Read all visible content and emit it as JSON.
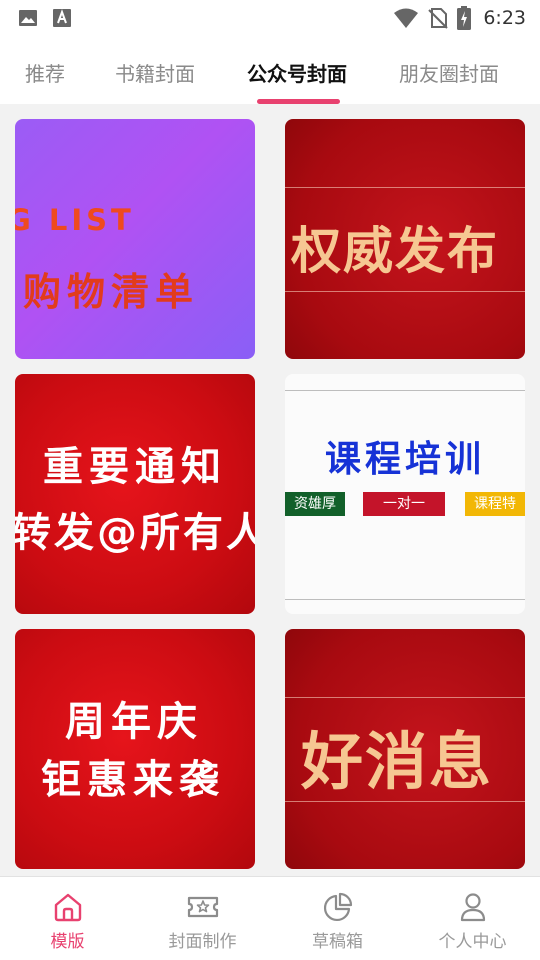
{
  "status_bar": {
    "time": "6:23",
    "icons": [
      "image-icon",
      "text-a-icon",
      "wifi-icon",
      "no-sim-icon",
      "battery-charging-icon"
    ]
  },
  "tabs": [
    {
      "label": "推荐",
      "active": false
    },
    {
      "label": "书籍封面",
      "active": false
    },
    {
      "label": "公众号封面",
      "active": true
    },
    {
      "label": "朋友圈封面",
      "active": false
    }
  ],
  "colors": {
    "accent": "#e8416f",
    "gold_text": "#f6c792",
    "blue_title": "#1632d6"
  },
  "cards": {
    "shopping": {
      "en": "G LIST",
      "cn": "购物清单"
    },
    "authority": {
      "title": "权威发布"
    },
    "notice": {
      "line1": "重要通知",
      "line2": "转发@所有人"
    },
    "course": {
      "title": "课程培训",
      "pills": [
        {
          "text": "资雄厚",
          "color": "#12602a"
        },
        {
          "text": "一对一",
          "color": "#c4142a"
        },
        {
          "text": "课程特",
          "color": "#f2b705"
        }
      ]
    },
    "anniversary": {
      "line1": "周年庆",
      "line2": "钜惠来袭"
    },
    "good_news": {
      "title": "好消息"
    }
  },
  "bottom_nav": [
    {
      "label": "模版",
      "icon": "home-icon",
      "active": true
    },
    {
      "label": "封面制作",
      "icon": "ticket-star-icon",
      "active": false
    },
    {
      "label": "草稿箱",
      "icon": "pie-chart-icon",
      "active": false
    },
    {
      "label": "个人中心",
      "icon": "person-icon",
      "active": false
    }
  ]
}
